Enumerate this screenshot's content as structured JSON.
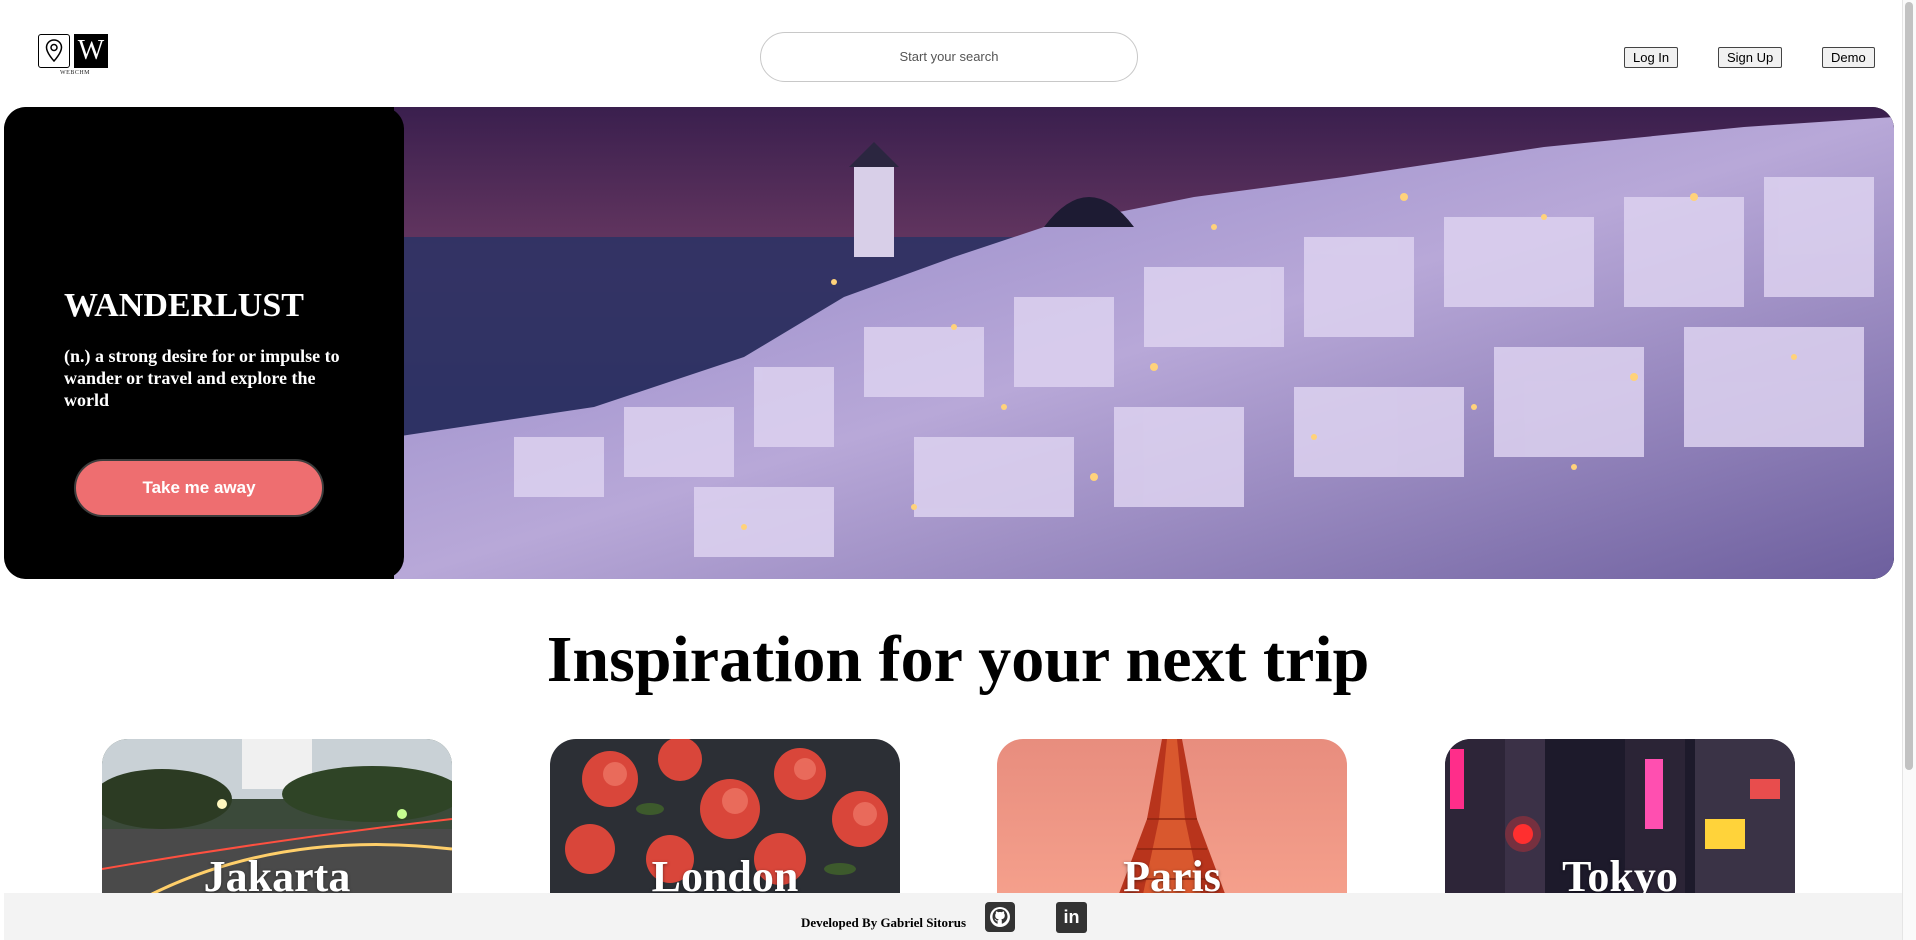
{
  "header": {
    "logo_letter": "W",
    "logo_caption": "WEBCHM",
    "search_placeholder": "Start your search",
    "login_label": "Log In",
    "signup_label": "Sign Up",
    "demo_label": "Demo"
  },
  "hero": {
    "title": "WANDERLUST",
    "definition": "(n.) a strong desire for or impulse to wander or travel and explore the world",
    "cta_label": "Take me away"
  },
  "inspiration": {
    "heading": "Inspiration for your next trip",
    "cities": [
      "Jakarta",
      "London",
      "Paris",
      "Tokyo"
    ]
  },
  "footer": {
    "credit": "Developed By Gabriel Sitorus",
    "linkedin_text": "in"
  },
  "icons": {
    "logo": "location-pin-icon",
    "github": "github-icon",
    "linkedin": "linkedin-icon"
  },
  "colors": {
    "cta": "#ee6e70",
    "hero_panel": "#000000",
    "footer_bg": "#f3f3f3"
  }
}
